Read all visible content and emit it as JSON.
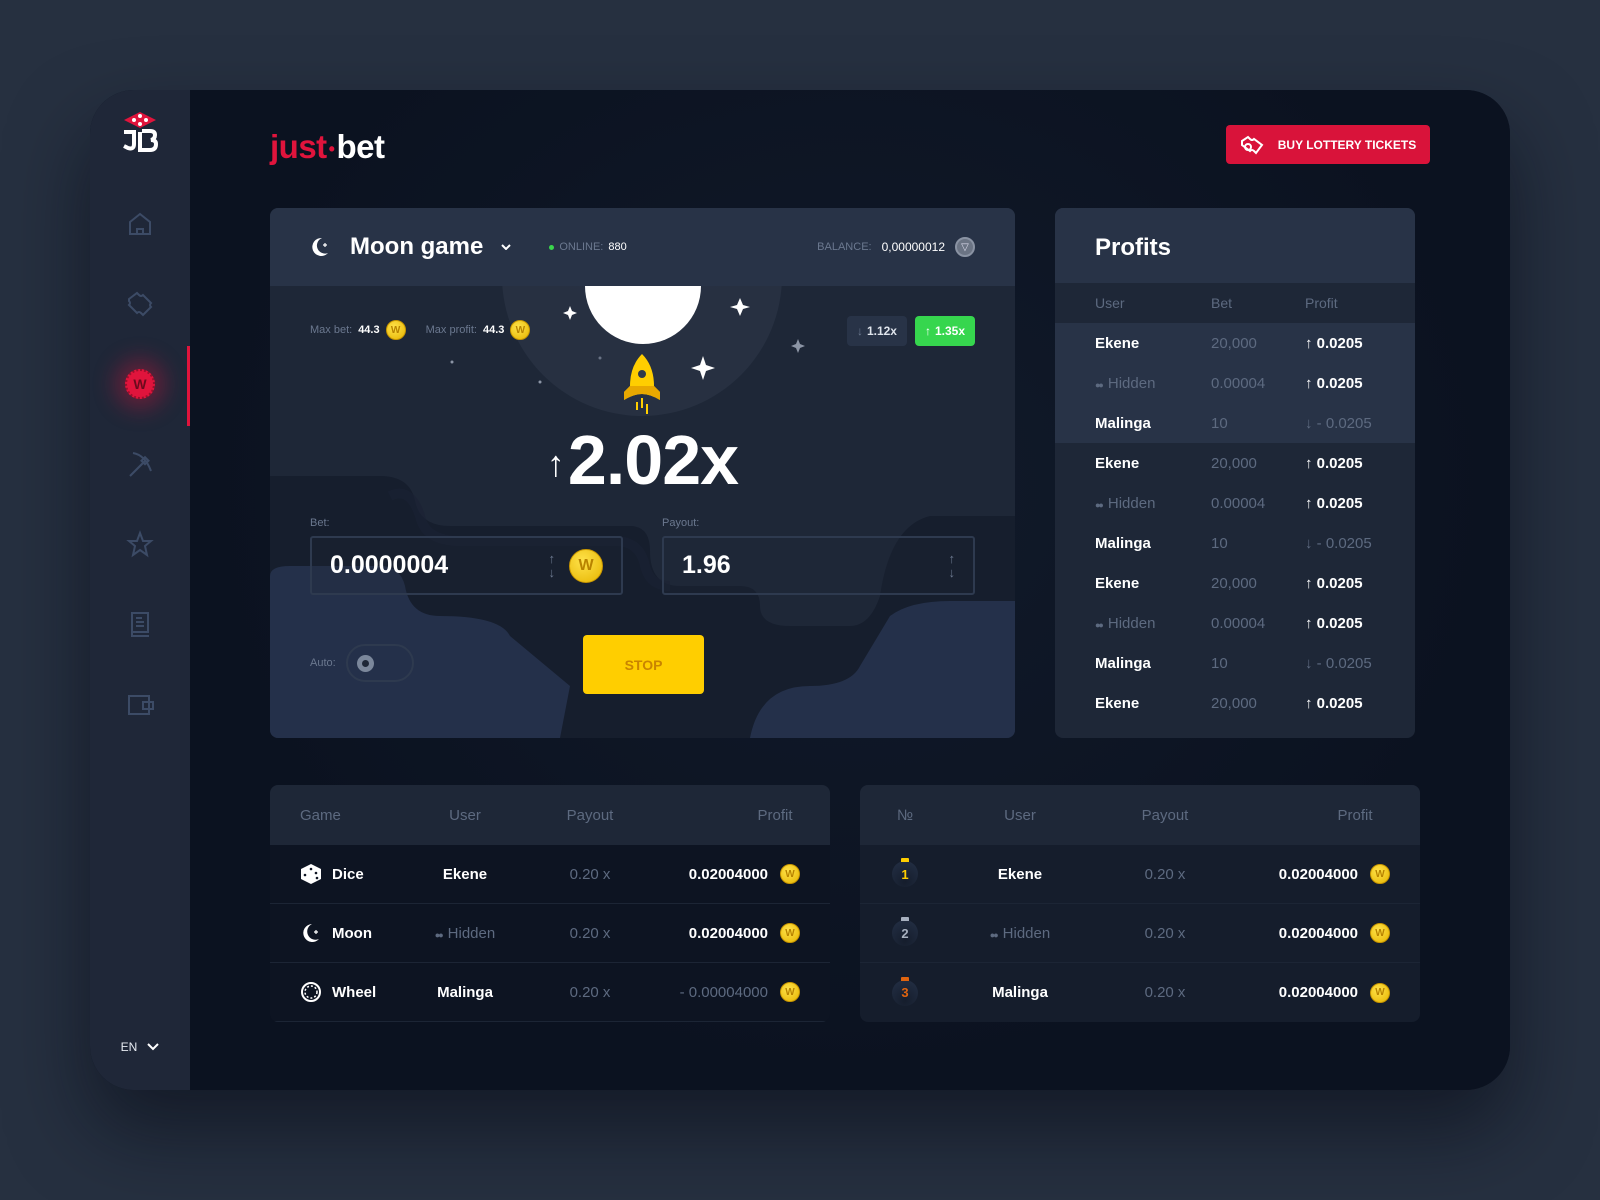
{
  "sidebar": {
    "logo": "JB",
    "items": [
      {
        "name": "home",
        "icon": "home-icon",
        "active": false
      },
      {
        "name": "tickets",
        "icon": "ticket-icon",
        "active": false
      },
      {
        "name": "coin",
        "icon": "coin-icon",
        "active": true,
        "glyph": "W"
      },
      {
        "name": "mining",
        "icon": "pickaxe-icon",
        "active": false
      },
      {
        "name": "favorites",
        "icon": "star-icon",
        "active": false
      },
      {
        "name": "rules",
        "icon": "book-icon",
        "active": false
      },
      {
        "name": "wallet",
        "icon": "wallet-icon",
        "active": false
      }
    ],
    "language": "EN"
  },
  "header": {
    "brand_part1": "just",
    "brand_sep": "•",
    "brand_part2": "bet",
    "lottery_button": "BUY LOTTERY TICKETS"
  },
  "game": {
    "title": "Moon game",
    "online_label": "ONLINE:",
    "online_count": "880",
    "balance_label": "BALANCE:",
    "balance_value": "0,00000012",
    "max_bet_label": "Max bet:",
    "max_bet_value": "44.3",
    "max_profit_label": "Max profit:",
    "max_profit_value": "44.3",
    "history": [
      {
        "direction": "down",
        "arrow": "↓",
        "value": "1.12x"
      },
      {
        "direction": "up",
        "arrow": "↑",
        "value": "1.35x"
      }
    ],
    "multiplier_arrow": "↑",
    "multiplier": "2.02x",
    "bet_label": "Bet:",
    "bet_value": "0.0000004",
    "payout_label": "Payout:",
    "payout_value": "1.96",
    "auto_label": "Auto:",
    "auto_on": false,
    "stop_button": "STOP",
    "coin_glyph": "W"
  },
  "profits": {
    "title": "Profits",
    "columns": [
      "User",
      "Bet",
      "Profit"
    ],
    "rows": [
      {
        "user": "Ekene",
        "hidden": false,
        "bet": "20,000",
        "profit": "↑ 0.0205",
        "negative": false
      },
      {
        "user": "Hidden",
        "hidden": true,
        "bet": "0.00004",
        "profit": "↑ 0.0205",
        "negative": false
      },
      {
        "user": "Malinga",
        "hidden": false,
        "bet": "10",
        "profit": "↓ - 0.0205",
        "negative": true
      },
      {
        "user": "Ekene",
        "hidden": false,
        "bet": "20,000",
        "profit": "↑ 0.0205",
        "negative": false
      },
      {
        "user": "Hidden",
        "hidden": true,
        "bet": "0.00004",
        "profit": "↑ 0.0205",
        "negative": false
      },
      {
        "user": "Malinga",
        "hidden": false,
        "bet": "10",
        "profit": "↓ - 0.0205",
        "negative": true
      },
      {
        "user": "Ekene",
        "hidden": false,
        "bet": "20,000",
        "profit": "↑ 0.0205",
        "negative": false
      },
      {
        "user": "Hidden",
        "hidden": true,
        "bet": "0.00004",
        "profit": "↑ 0.0205",
        "negative": false
      },
      {
        "user": "Malinga",
        "hidden": false,
        "bet": "10",
        "profit": "↓ - 0.0205",
        "negative": true
      },
      {
        "user": "Ekene",
        "hidden": false,
        "bet": "20,000",
        "profit": "↑ 0.0205",
        "negative": false
      }
    ]
  },
  "bets_table": {
    "columns": [
      "Game",
      "User",
      "Payout",
      "Profit"
    ],
    "rows": [
      {
        "game": "Dice",
        "icon": "dice-icon",
        "user": "Ekene",
        "hidden": false,
        "payout": "0.20 x",
        "profit": "0.02004000",
        "negative": false
      },
      {
        "game": "Moon",
        "icon": "moon-icon",
        "user": "Hidden",
        "hidden": true,
        "payout": "0.20 x",
        "profit": "0.02004000",
        "negative": false
      },
      {
        "game": "Wheel",
        "icon": "wheel-icon",
        "user": "Malinga",
        "hidden": false,
        "payout": "0.20 x",
        "profit": "- 0.00004000",
        "negative": true
      }
    ]
  },
  "leaders_table": {
    "columns": [
      "№",
      "User",
      "Payout",
      "Profit"
    ],
    "rows": [
      {
        "rank": "1",
        "medal": "gold",
        "user": "Ekene",
        "hidden": false,
        "payout": "0.20 x",
        "profit": "0.02004000"
      },
      {
        "rank": "2",
        "medal": "silver",
        "user": "Hidden",
        "hidden": true,
        "payout": "0.20 x",
        "profit": "0.02004000"
      },
      {
        "rank": "3",
        "medal": "bronze",
        "user": "Malinga",
        "hidden": false,
        "payout": "0.20 x",
        "profit": "0.02004000"
      }
    ]
  },
  "colors": {
    "accent_red": "#e0143c",
    "accent_yellow": "#ffce00",
    "accent_green": "#36d64e",
    "panel": "#1e2737",
    "panel_header": "#283347",
    "muted_text": "#5d6a80"
  }
}
